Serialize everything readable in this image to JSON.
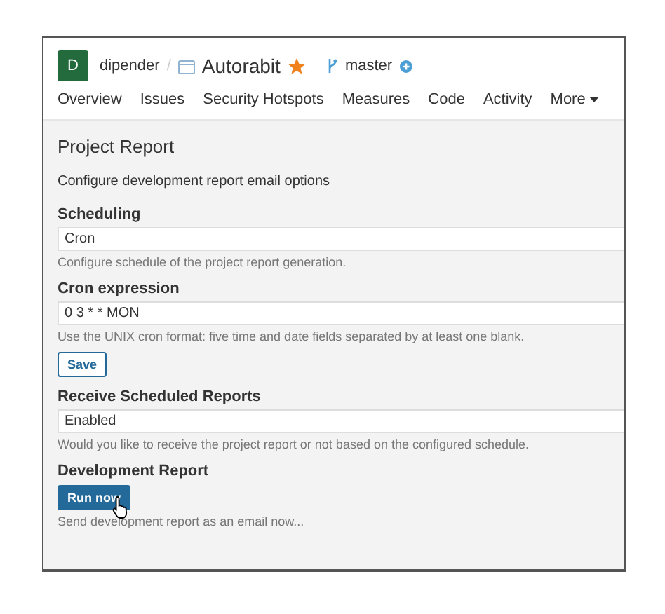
{
  "header": {
    "avatar": "D",
    "owner": "dipender",
    "separator": "/",
    "project": "Autorabit",
    "favorite": true,
    "branch": "master"
  },
  "tabs": [
    {
      "label": "Overview",
      "selected": false
    },
    {
      "label": "Issues",
      "selected": false
    },
    {
      "label": "Security Hotspots",
      "selected": false
    },
    {
      "label": "Measures",
      "selected": false
    },
    {
      "label": "Code",
      "selected": false
    },
    {
      "label": "Activity",
      "selected": false
    },
    {
      "label": "More",
      "selected": false
    }
  ],
  "page_title": "Project Report",
  "subtitle": "Configure development report email options",
  "sections": [
    {
      "kind": "field",
      "label": "Scheduling",
      "value": "Cron",
      "help": "Configure schedule of the project report generation."
    },
    {
      "kind": "field",
      "label": "Cron expression",
      "value": "0 3 * * MON",
      "help": "Use the UNIX cron format: five time and date fields separated by at least one blank.",
      "button": "Save"
    },
    {
      "kind": "field",
      "label": "Receive Scheduled Reports",
      "value": "Enabled",
      "help": "Would you like to receive the project report or not based on the configured schedule."
    },
    {
      "kind": "action",
      "label": "Development Report",
      "button": "Run now",
      "help": "Send development report as an email now..."
    }
  ]
}
